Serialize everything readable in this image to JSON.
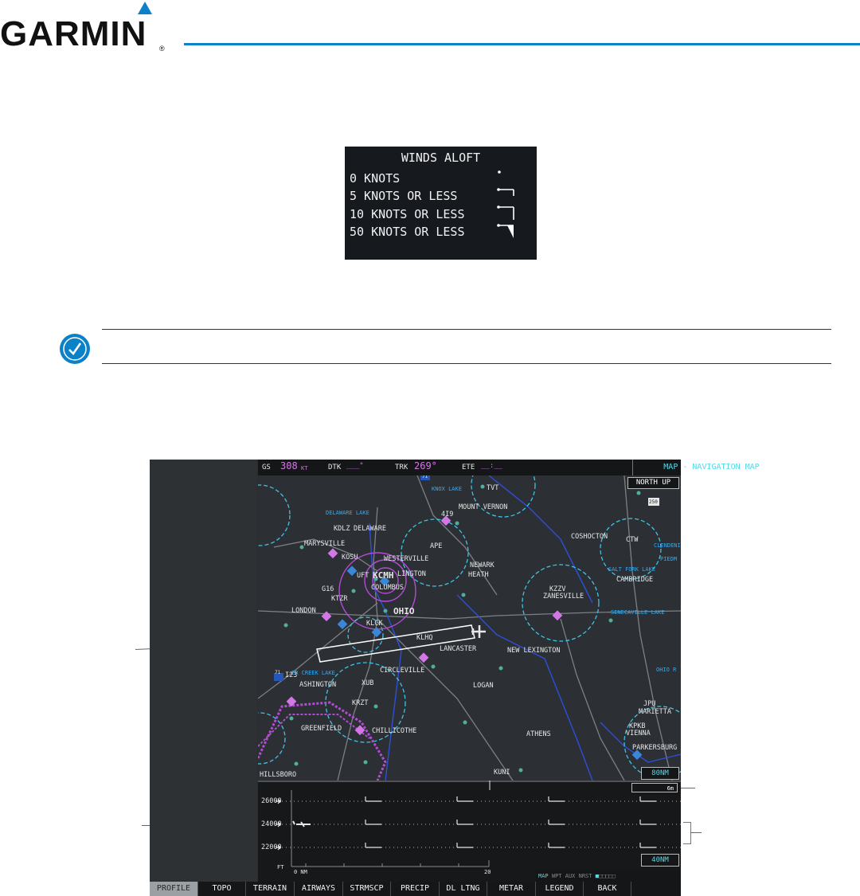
{
  "header": {
    "brand": "GARMIN",
    "registered": "®"
  },
  "winds_legend": {
    "title": "WINDS ALOFT",
    "rows": [
      {
        "label": "0 KNOTS",
        "icon": "calm-dot-icon"
      },
      {
        "label": "5 KNOTS OR LESS",
        "icon": "half-barb-icon"
      },
      {
        "label": "10 KNOTS OR LESS",
        "icon": "full-barb-icon"
      },
      {
        "label": "50 KNOTS OR LESS",
        "icon": "pennant-icon"
      }
    ]
  },
  "note": {
    "icon": "note-check-icon"
  },
  "top_bar": {
    "gs_label": "GS",
    "gs_value": "308",
    "gs_unit": "KT",
    "dtk_label": "DTK",
    "dtk_value": "___°",
    "trk_label": "TRK",
    "trk_value": "269°",
    "ete_label": "ETE",
    "ete_value": "__:__",
    "page_title": "MAP - NAVIGATION MAP"
  },
  "map": {
    "orientation": "NORTH UP",
    "range": "80NM",
    "labels": {
      "knox_lake": "KNOX LAKE",
      "tvt": "TVT",
      "mount_vernon": "MOUNT VERNON",
      "delaware_lake": "DELAWARE LAKE",
      "419": "4I9",
      "kdlz": "KDLZ",
      "delaware": "DELAWARE",
      "coshocton": "COSHOCTON",
      "ctw": "CTW",
      "clendening": "CLENDENING",
      "marysville": "MARYSVILLE",
      "ape": "APE",
      "kosu": "KOSU",
      "westerville": "WESTERVILLE",
      "newark": "NEWARK",
      "heath": "HEATH",
      "piedmont": "PIEDM",
      "salt_fork": "SALT FORK LAKE",
      "cambridge": "CAMBRIDGE",
      "kcmh": "KCMH",
      "uft": "UFT",
      "arlington": "LINGTON",
      "columbus": "COLUMBUS",
      "g16": "G16",
      "ktzr": "KTZR",
      "kzzv": "KZZV",
      "zanesville": "ZANESVILLE",
      "london": "LONDON",
      "ohio": "OHIO",
      "seneca": "SENECAVILLE LAKE",
      "klck": "KLCK",
      "klhq": "KLHQ",
      "lancaster": "LANCASTER",
      "new_lexington": "NEW LEXINGTON",
      "creek_lake": "ER CREEK LAKE",
      "i23": "I23",
      "washington": "ASHINGTON",
      "circleville": "CIRCLEVILLE",
      "xub": "XUB",
      "logan": "LOGAN",
      "ohio_r": "OHIO R",
      "krzt": "KRZT",
      "jpu": "JPU",
      "marietta": "MARIETTA",
      "greenfield": "GREENFIELD",
      "chillicothe": "CHILLICOTHE",
      "athens": "ATHENS",
      "kpkb": "KPKB",
      "vienna": "VIENNA",
      "parkersburg": "PARKERSBURG",
      "hillsboro": "HILLSBORO",
      "kuni": "KUNI",
      "i71_top": "71",
      "i71": "71",
      "us250": "250"
    }
  },
  "profile": {
    "altitudes": [
      "26000",
      "24000",
      "22000"
    ],
    "unit_ft": "FT",
    "axis_start": "0 NM",
    "axis_mid": "20",
    "range": "40NM",
    "wind_scale": "6m",
    "page_group": [
      "MAP",
      "WPT",
      "AUX",
      "NRST"
    ]
  },
  "softkeys": [
    "PROFILE",
    "TOPO",
    "TERRAIN",
    "AIRWAYS",
    "STRMSCP",
    "PRECIP",
    "DL LTNG",
    "METAR",
    "LEGEND",
    "BACK",
    ""
  ],
  "colors": {
    "accent_blue": "#0b82c8",
    "magenta": "#d477e6",
    "cyan": "#57d9e6"
  }
}
